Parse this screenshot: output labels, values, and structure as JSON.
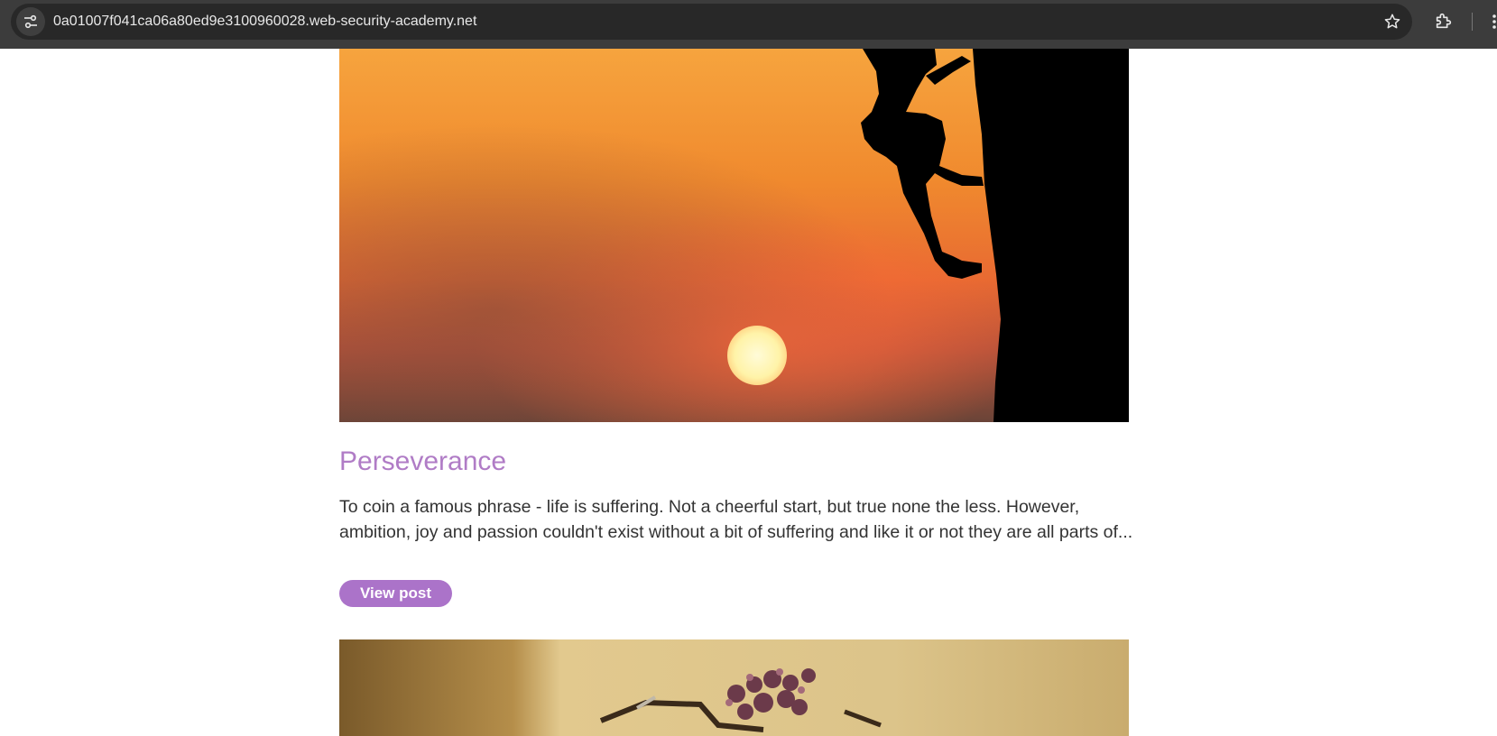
{
  "browser": {
    "url": "0a01007f041ca06a80ed9e3100960028.web-security-academy.net",
    "icons": [
      "site-info-icon",
      "bookmark-star-icon",
      "extensions-icon",
      "menu-icon"
    ]
  },
  "posts": [
    {
      "image": "sunset-climber-image",
      "title": "Perseverance",
      "summary": "To coin a famous phrase - life is suffering. Not a cheerful start, but true none the less. However, ambition, joy and passion couldn't exist without a bit of suffering and like it or not they are all parts of...",
      "button_label": "View post"
    },
    {
      "image": "bicycle-flowers-image"
    }
  ],
  "colors": {
    "title": "#b07cc6",
    "button": "#ab73c9",
    "text": "#333333"
  }
}
